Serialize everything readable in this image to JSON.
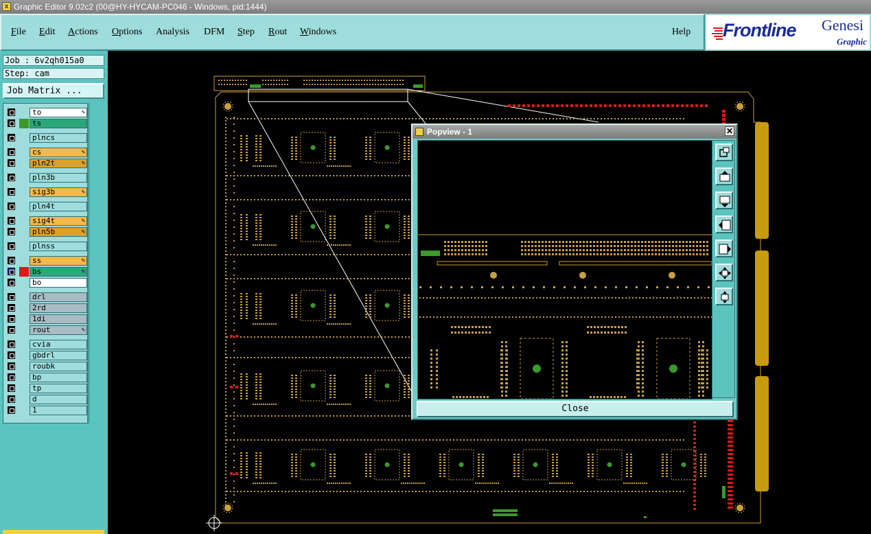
{
  "window": {
    "title": "Graphic Editor 9.02c2 (00@HY-HYCAM-PC046 - Windows, pid:1444)"
  },
  "menu": {
    "items": [
      {
        "label": "File",
        "key": "F",
        "rest": "ile"
      },
      {
        "label": "Edit",
        "key": "E",
        "rest": "dit"
      },
      {
        "label": "Actions",
        "key": "A",
        "rest": "ctions"
      },
      {
        "label": "Options",
        "key": "O",
        "rest": "ptions"
      },
      {
        "label": "Analysis",
        "key": "A",
        "rest": "nalysis"
      },
      {
        "label": "DFM",
        "key": "D",
        "rest": "FM"
      },
      {
        "label": "Step",
        "key": "S",
        "rest": "tep"
      },
      {
        "label": "Rout",
        "key": "R",
        "rest": "out"
      },
      {
        "label": "Windows",
        "key": "W",
        "rest": "indows"
      }
    ],
    "help": "Help"
  },
  "logo": {
    "brand": "Frontline",
    "product": "Genesi",
    "subtitle": "Graphic"
  },
  "sidebar": {
    "job": "Job : 6v2qh015a0",
    "step": "Step: cam",
    "job_matrix": "Job Matrix ...",
    "layers": [
      {
        "name": "to",
        "color": "#ffffff",
        "flag": "",
        "brush": true
      },
      {
        "name": "ts",
        "color": "#2aa87a",
        "flag": "#3a9a2a",
        "brush": false
      },
      {
        "name": "plncs",
        "color": "#9fdcdc",
        "flag": "",
        "brush": false
      },
      {
        "name": "cs",
        "color": "#f5b84b",
        "flag": "",
        "brush": true
      },
      {
        "name": "pln2t",
        "color": "#d9a12b",
        "flag": "",
        "brush": true
      },
      {
        "name": "pln3b",
        "color": "#9fdcdc",
        "flag": "",
        "brush": false
      },
      {
        "name": "sig3b",
        "color": "#f5b84b",
        "flag": "",
        "brush": true
      },
      {
        "name": "pln4t",
        "color": "#9fdcdc",
        "flag": "",
        "brush": false
      },
      {
        "name": "sig4t",
        "color": "#f5b84b",
        "flag": "",
        "brush": true
      },
      {
        "name": "pln5b",
        "color": "#d9a12b",
        "flag": "",
        "brush": true
      },
      {
        "name": "plnss",
        "color": "#9fdcdc",
        "flag": "",
        "brush": false
      },
      {
        "name": "ss",
        "color": "#f5b84b",
        "flag": "",
        "brush": true
      },
      {
        "name": "bs",
        "color": "#2aa87a",
        "flag": "#e01818",
        "brush": true
      },
      {
        "name": "bo",
        "color": "#ffffff",
        "flag": "",
        "brush": false
      },
      {
        "name": "drl",
        "color": "#a9bcc4",
        "flag": "",
        "brush": false
      },
      {
        "name": "2rd",
        "color": "#a9bcc4",
        "flag": "",
        "brush": false
      },
      {
        "name": "1di",
        "color": "#a9bcc4",
        "flag": "",
        "brush": false
      },
      {
        "name": "rout",
        "color": "#a9bcc4",
        "flag": "",
        "brush": true
      },
      {
        "name": "cvia",
        "color": "#9fdcdc",
        "flag": "",
        "brush": false
      },
      {
        "name": "gbdrl",
        "color": "#9fdcdc",
        "flag": "",
        "brush": false
      },
      {
        "name": "roubk",
        "color": "#9fdcdc",
        "flag": "",
        "brush": false
      },
      {
        "name": "bp",
        "color": "#9fdcdc",
        "flag": "",
        "brush": false
      },
      {
        "name": "tp",
        "color": "#9fdcdc",
        "flag": "",
        "brush": false
      },
      {
        "name": "d",
        "color": "#9fdcdc",
        "flag": "",
        "brush": false
      },
      {
        "name": "1",
        "color": "#9fdcdc",
        "flag": "",
        "brush": false
      }
    ]
  },
  "popview": {
    "title": "Popview - 1",
    "close_label": "Close",
    "tools": [
      "zoom-window-icon",
      "pan-up-icon",
      "pan-down-icon",
      "pan-left-icon",
      "pan-right-icon",
      "zoom-fit-icon",
      "zoom-home-icon"
    ]
  },
  "colors": {
    "pad": "#c8a040",
    "copper_green": "#3a9a2a",
    "board_outline": "#c8a040",
    "edge_gold": "#c89a10",
    "marker_red": "#e01818"
  }
}
